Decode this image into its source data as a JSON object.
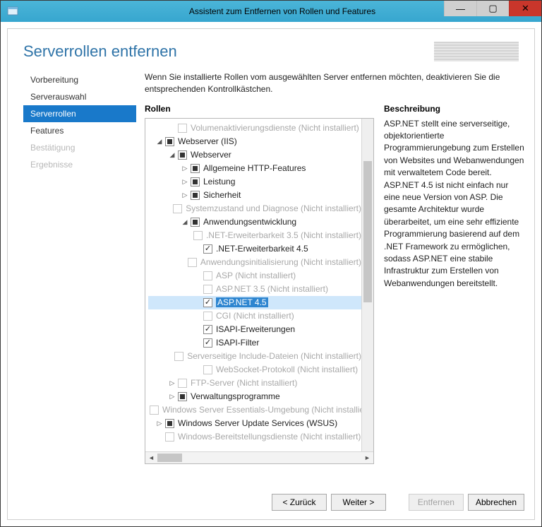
{
  "window": {
    "title": "Assistent zum Entfernen von Rollen und Features"
  },
  "page_title": "Serverrollen entfernen",
  "instruction": "Wenn Sie installierte Rollen vom ausgewählten Server entfernen möchten, deaktivieren Sie die entsprechenden Kontrollkästchen.",
  "roles_heading": "Rollen",
  "description_heading": "Beschreibung",
  "description_text": "ASP.NET stellt eine serverseitige, objektorientierte Programmierungebung zum Erstellen von Websites und Webanwendungen mit verwaltetem Code bereit. ASP.NET 4.5 ist nicht einfach nur eine neue Version von ASP. Die gesamte Architektur wurde überarbeitet, um eine sehr effiziente Programmierung basierend auf dem .NET Framework zu ermöglichen, sodass ASP.NET eine stabile Infrastruktur zum Erstellen von Webanwendungen bereitstellt.",
  "sidebar": {
    "items": [
      {
        "label": "Vorbereitung",
        "state": "normal"
      },
      {
        "label": "Serverauswahl",
        "state": "normal"
      },
      {
        "label": "Serverrollen",
        "state": "active"
      },
      {
        "label": "Features",
        "state": "normal"
      },
      {
        "label": "Bestätigung",
        "state": "disabled"
      },
      {
        "label": "Ergebnisse",
        "state": "disabled"
      }
    ]
  },
  "tree": [
    {
      "indent": 1,
      "expander": "blank",
      "cb": "disabled",
      "label": "Volumenaktivierungsdienste (Nicht installiert)",
      "disabled": true
    },
    {
      "indent": 0,
      "expander": "open",
      "cb": "partial",
      "label": "Webserver (IIS)"
    },
    {
      "indent": 1,
      "expander": "open",
      "cb": "partial",
      "label": "Webserver"
    },
    {
      "indent": 2,
      "expander": "closed",
      "cb": "partial",
      "label": "Allgemeine HTTP-Features"
    },
    {
      "indent": 2,
      "expander": "closed",
      "cb": "partial",
      "label": "Leistung"
    },
    {
      "indent": 2,
      "expander": "closed",
      "cb": "partial",
      "label": "Sicherheit"
    },
    {
      "indent": 2,
      "expander": "blank",
      "cb": "disabled",
      "label": "Systemzustand und Diagnose (Nicht installiert)",
      "disabled": true
    },
    {
      "indent": 2,
      "expander": "open",
      "cb": "partial",
      "label": "Anwendungsentwicklung"
    },
    {
      "indent": 3,
      "expander": "blank",
      "cb": "disabled",
      "label": ".NET-Erweiterbarkeit 3.5 (Nicht installiert)",
      "disabled": true
    },
    {
      "indent": 3,
      "expander": "blank",
      "cb": "checked",
      "label": ".NET-Erweiterbarkeit 4.5"
    },
    {
      "indent": 3,
      "expander": "blank",
      "cb": "disabled",
      "label": "Anwendungsinitialisierung (Nicht installiert)",
      "disabled": true
    },
    {
      "indent": 3,
      "expander": "blank",
      "cb": "disabled",
      "label": "ASP (Nicht installiert)",
      "disabled": true
    },
    {
      "indent": 3,
      "expander": "blank",
      "cb": "disabled",
      "label": "ASP.NET 3.5 (Nicht installiert)",
      "disabled": true
    },
    {
      "indent": 3,
      "expander": "blank",
      "cb": "checked",
      "label": "ASP.NET 4.5",
      "selected": true
    },
    {
      "indent": 3,
      "expander": "blank",
      "cb": "disabled",
      "label": "CGI (Nicht installiert)",
      "disabled": true
    },
    {
      "indent": 3,
      "expander": "blank",
      "cb": "checked",
      "label": "ISAPI-Erweiterungen"
    },
    {
      "indent": 3,
      "expander": "blank",
      "cb": "checked",
      "label": "ISAPI-Filter"
    },
    {
      "indent": 3,
      "expander": "blank",
      "cb": "disabled",
      "label": "Serverseitige Include-Dateien (Nicht installiert)",
      "disabled": true
    },
    {
      "indent": 3,
      "expander": "blank",
      "cb": "disabled",
      "label": "WebSocket-Protokoll (Nicht installiert)",
      "disabled": true
    },
    {
      "indent": 1,
      "expander": "closed",
      "cb": "disabled",
      "label": "FTP-Server (Nicht installiert)",
      "disabled": true
    },
    {
      "indent": 1,
      "expander": "closed",
      "cb": "partial",
      "label": "Verwaltungsprogramme"
    },
    {
      "indent": 0,
      "expander": "blank",
      "cb": "disabled",
      "label": "Windows Server Essentials-Umgebung (Nicht installiert)",
      "disabled": true
    },
    {
      "indent": 0,
      "expander": "closed",
      "cb": "partial",
      "label": "Windows Server Update Services (WSUS)"
    },
    {
      "indent": 0,
      "expander": "blank",
      "cb": "disabled",
      "label": "Windows-Bereitstellungsdienste (Nicht installiert)",
      "disabled": true
    }
  ],
  "footer": {
    "back": "< Zurück",
    "next": "Weiter >",
    "remove": "Entfernen",
    "cancel": "Abbrechen"
  }
}
